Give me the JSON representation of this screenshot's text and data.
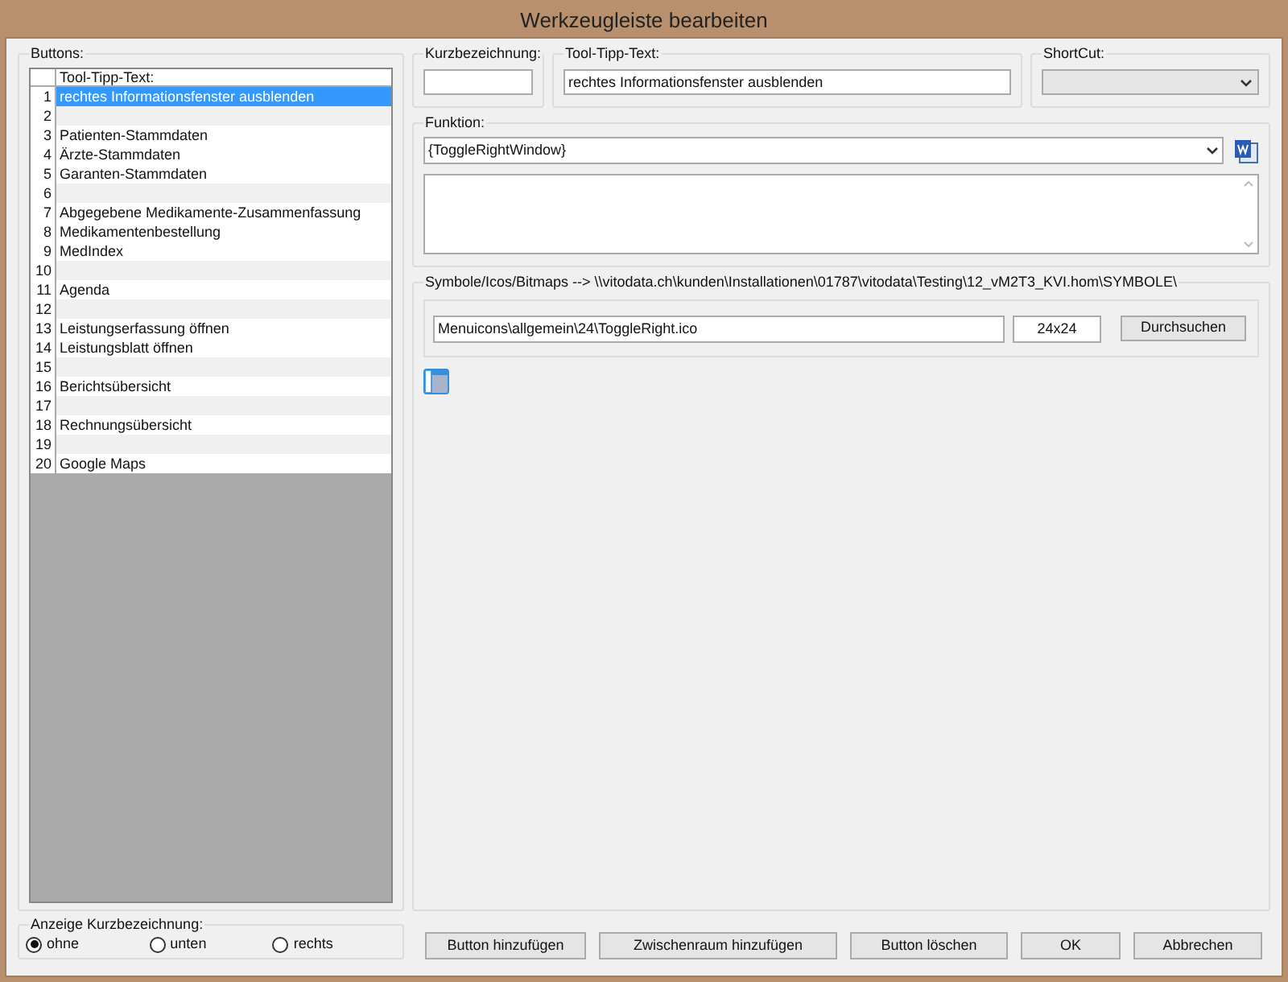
{
  "window": {
    "title": "Werkzeugleiste bearbeiten"
  },
  "buttons_group": {
    "label": "Buttons:",
    "header": "Tool-Tipp-Text:",
    "rows": [
      {
        "number": "1",
        "text": "rechtes Informationsfenster ausblenden",
        "selected": true
      },
      {
        "number": "2",
        "selected": false
      },
      {
        "number": "3",
        "text": "Patienten-Stammdaten",
        "selected": false
      },
      {
        "number": "4",
        "text": "Ärzte-Stammdaten",
        "selected": false
      },
      {
        "number": "5",
        "text": "Garanten-Stammdaten",
        "selected": false
      },
      {
        "number": "6",
        "selected": false
      },
      {
        "number": "7",
        "text": "Abgegebene Medikamente-Zusammenfassung",
        "selected": false
      },
      {
        "number": "8",
        "text": "Medikamentenbestellung",
        "selected": false
      },
      {
        "number": "9",
        "text": "MedIndex",
        "selected": false
      },
      {
        "number": "10",
        "selected": false
      },
      {
        "number": "11",
        "text": "Agenda",
        "selected": false
      },
      {
        "number": "12",
        "selected": false
      },
      {
        "number": "13",
        "text": "Leistungserfassung öffnen",
        "selected": false
      },
      {
        "number": "14",
        "text": "Leistungsblatt öffnen",
        "selected": false
      },
      {
        "number": "15",
        "selected": false
      },
      {
        "number": "16",
        "text": "Berichtsübersicht",
        "selected": false
      },
      {
        "number": "17",
        "selected": false
      },
      {
        "number": "18",
        "text": "Rechnungsübersicht",
        "selected": false
      },
      {
        "number": "19",
        "selected": false
      },
      {
        "number": "20",
        "text": "Google Maps",
        "selected": false
      }
    ]
  },
  "kurzbezeichnung": {
    "label": "Kurzbezeichnung:"
  },
  "tooltip": {
    "label": "Tool-Tipp-Text:",
    "value": "rechtes Informationsfenster ausblenden"
  },
  "shortcut": {
    "label": "ShortCut:"
  },
  "funktion": {
    "label": "Funktion:",
    "value": "{ToggleRightWindow}"
  },
  "symbole": {
    "label": "Symbole/Icos/Bitmaps --> \\\\vitodata.ch\\kunden\\Installationen\\01787\\vitodata\\Testing\\12_vM2T3_KVI.hom\\SYMBOLE\\",
    "path": "Menuicons\\allgemein\\24\\ToggleRight.ico",
    "size": "24x24",
    "browse": "Durchsuchen"
  },
  "anzeige": {
    "label": "Anzeige Kurzbezeichnung:",
    "options": [
      {
        "label": "ohne",
        "selected": true
      },
      {
        "label": "unten",
        "selected": false
      },
      {
        "label": "rechts",
        "selected": false
      }
    ]
  },
  "actions": [
    "Button hinzufügen",
    "Zwischenraum hinzufügen",
    "Button löschen",
    "OK",
    "Abbrechen"
  ]
}
